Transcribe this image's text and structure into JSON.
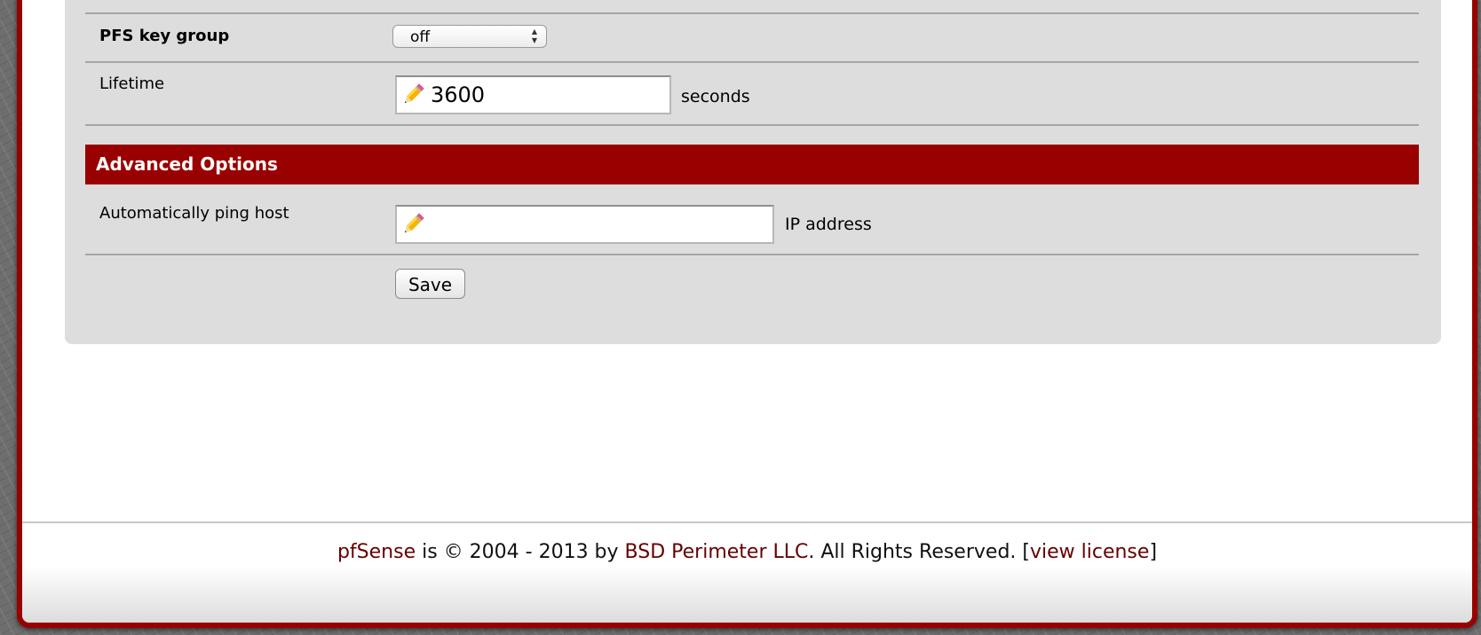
{
  "form": {
    "pfs_key_group": {
      "label": "PFS key group",
      "selected": "off"
    },
    "lifetime": {
      "label": "Lifetime",
      "value": "3600",
      "unit": "seconds"
    },
    "advanced_options": {
      "title": "Advanced Options"
    },
    "ping_host": {
      "label": "Automatically ping host",
      "value": "",
      "unit": "IP address"
    },
    "save_label": "Save"
  },
  "footer": {
    "product_link": "pfSense",
    "copyright_text": " is © 2004 - 2013 by ",
    "company_link": "BSD Perimeter LLC",
    "rights_text": ". All Rights Reserved. [",
    "license_link": "view license",
    "close_bracket": "]"
  },
  "colors": {
    "brand_red": "#990000",
    "link_red": "#660000",
    "panel_gray": "#dddddd"
  }
}
